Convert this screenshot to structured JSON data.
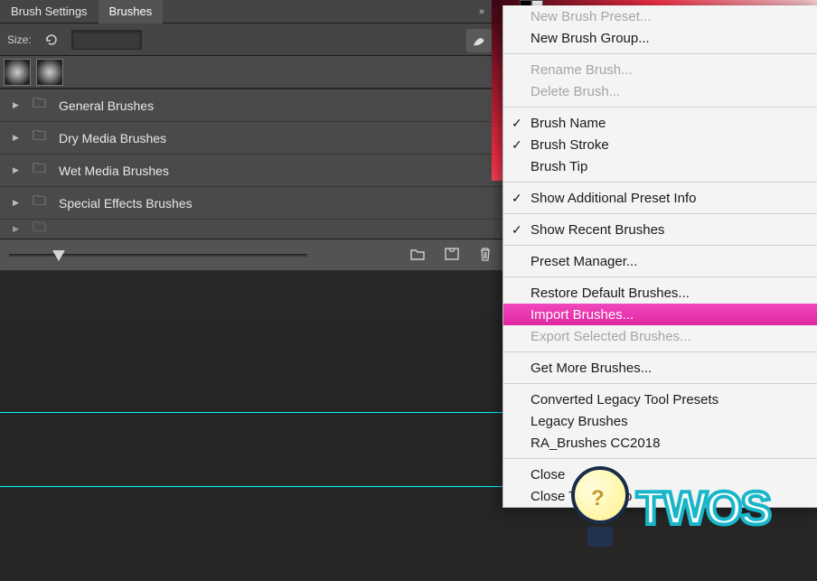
{
  "tabs": {
    "settings_label": "Brush Settings",
    "brushes_label": "Brushes"
  },
  "size_bar": {
    "label": "Size:",
    "value": ""
  },
  "folders": [
    {
      "label": "General Brushes"
    },
    {
      "label": "Dry Media Brushes"
    },
    {
      "label": "Wet Media Brushes"
    },
    {
      "label": "Special Effects Brushes"
    }
  ],
  "menu": {
    "new_preset": "New Brush Preset...",
    "new_group": "New Brush Group...",
    "rename": "Rename Brush...",
    "delete": "Delete Brush...",
    "brush_name": "Brush Name",
    "brush_stroke": "Brush Stroke",
    "brush_tip": "Brush Tip",
    "show_additional": "Show Additional Preset Info",
    "show_recent": "Show Recent Brushes",
    "preset_manager": "Preset Manager...",
    "restore_default": "Restore Default Brushes...",
    "import_brushes": "Import Brushes...",
    "export_selected": "Export Selected Brushes...",
    "get_more": "Get More Brushes...",
    "converted_legacy": "Converted Legacy Tool Presets",
    "legacy_brushes": "Legacy Brushes",
    "ra_brushes": "RA_Brushes CC2018",
    "close": "Close",
    "close_tab_group": "Close Tab Group"
  },
  "logo": {
    "text": "TWOS"
  }
}
